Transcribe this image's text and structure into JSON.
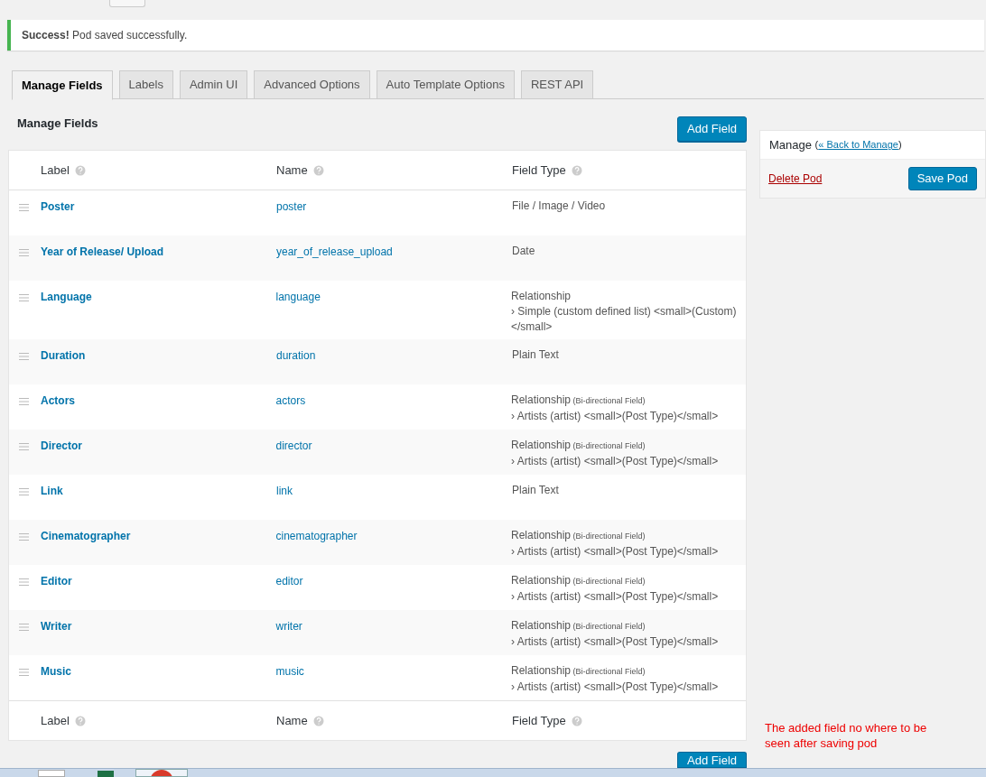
{
  "notice": {
    "strong": "Success!",
    "text": "Pod saved successfully."
  },
  "tabs": [
    {
      "label": "Manage Fields",
      "selected": true
    },
    {
      "label": "Labels",
      "selected": false
    },
    {
      "label": "Admin UI",
      "selected": false
    },
    {
      "label": "Advanced Options",
      "selected": false
    },
    {
      "label": "Auto Template Options",
      "selected": false
    },
    {
      "label": "REST API",
      "selected": false
    }
  ],
  "heading": "Manage Fields",
  "add_button": "Add Field",
  "columns": [
    "Label",
    "Name",
    "Field Type"
  ],
  "rows": [
    {
      "label": "Poster",
      "name": "poster",
      "type": "File / Image / Video"
    },
    {
      "label": "Year of Release/ Upload",
      "name": "year_of_release_upload",
      "type": "Date"
    },
    {
      "label": "Language",
      "name": "language",
      "type": "Relationship",
      "detail": "› Simple (custom defined list) <small>(Custom)</small>"
    },
    {
      "label": "Duration",
      "name": "duration",
      "type": "Plain Text"
    },
    {
      "label": "Actors",
      "name": "actors",
      "type": "Relationship",
      "note": "(Bi-directional Field)",
      "detail": "› Artists (artist) <small>(Post Type)</small>"
    },
    {
      "label": "Director",
      "name": "director",
      "type": "Relationship",
      "note": "(Bi-directional Field)",
      "detail": "› Artists (artist) <small>(Post Type)</small>"
    },
    {
      "label": "Link",
      "name": "link",
      "type": "Plain Text"
    },
    {
      "label": "Cinematographer",
      "name": "cinematographer",
      "type": "Relationship",
      "note": "(Bi-directional Field)",
      "detail": "› Artists (artist) <small>(Post Type)</small>"
    },
    {
      "label": "Editor",
      "name": "editor",
      "type": "Relationship",
      "note": "(Bi-directional Field)",
      "detail": "› Artists (artist) <small>(Post Type)</small>"
    },
    {
      "label": "Writer",
      "name": "writer",
      "type": "Relationship",
      "note": "(Bi-directional Field)",
      "detail": "› Artists (artist) <small>(Post Type)</small>"
    },
    {
      "label": "Music",
      "name": "music",
      "type": "Relationship",
      "note": "(Bi-directional Field)",
      "detail": "› Artists (artist) <small>(Post Type)</small>"
    }
  ],
  "footer_columns": [
    "Label",
    "Name",
    "Field Type"
  ],
  "bottom_button": "Add Field",
  "manage_box": {
    "title": "Manage",
    "link_open": "(",
    "link": "« Back to Manage",
    "link_close": ")",
    "delete": "Delete Pod",
    "save": "Save Pod"
  },
  "annotation": "The added field no where to be seen after saving pod"
}
